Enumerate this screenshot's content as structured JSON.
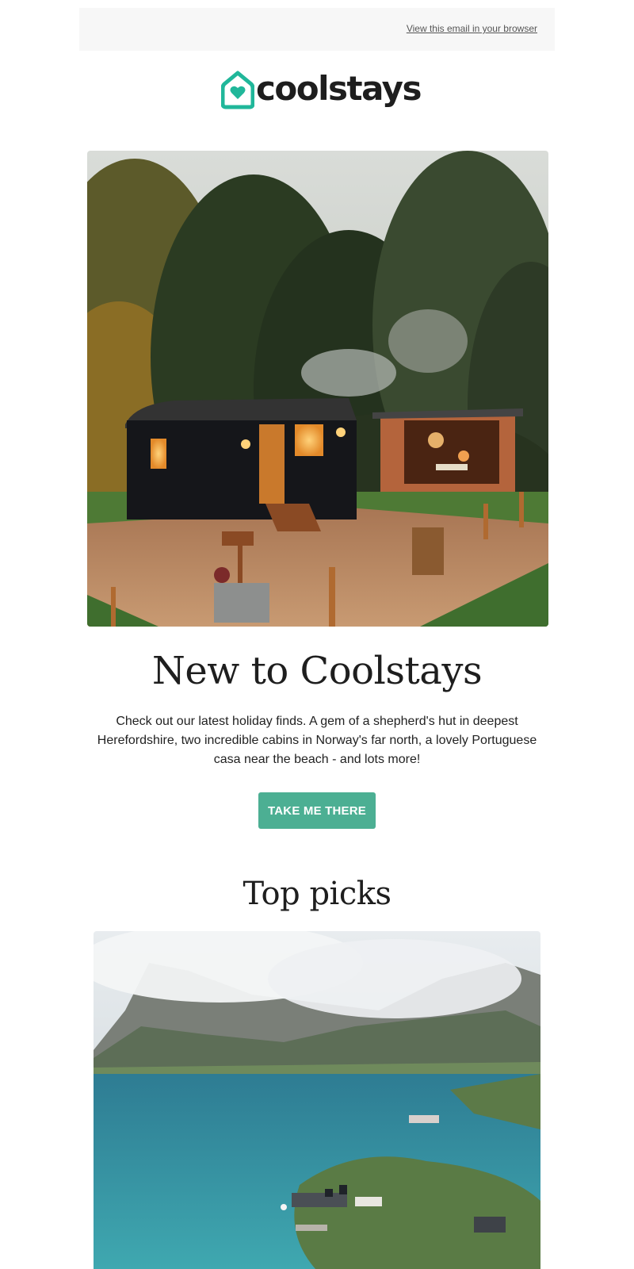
{
  "preheader": {
    "view_in_browser": "View this email in your browser"
  },
  "brand": {
    "name": "coolstays",
    "icon": "house-heart-icon",
    "accent": "#20b79a"
  },
  "hero": {
    "image_icon": "shepherds-hut-photo",
    "title": "New to Coolstays",
    "body": "Check out our latest holiday finds. A gem of a shepherd's hut in deepest Herefordshire, two incredible cabins in Norway's far north, a lovely Portuguese casa near the beach - and lots more!",
    "cta_label": "TAKE ME THERE",
    "cta_color": "#4caf93"
  },
  "top_picks": {
    "heading": "Top picks",
    "image_icon": "norway-fjord-photo"
  }
}
